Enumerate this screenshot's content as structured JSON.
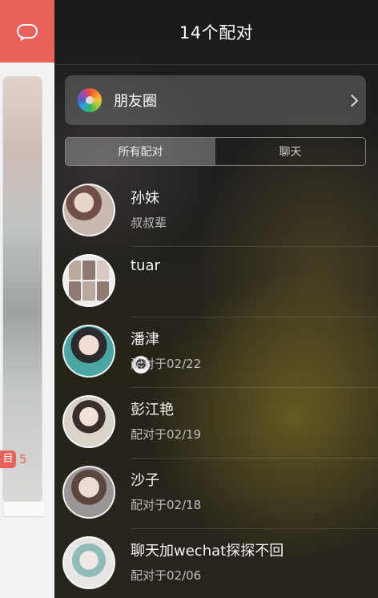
{
  "left_app": {
    "badge_glyph": "目",
    "count": "5",
    "accent_color": "#e8625a"
  },
  "header": {
    "title": "14个配对"
  },
  "moments": {
    "label": "朋友圈",
    "icon": "color-wheel-icon"
  },
  "tabs": [
    {
      "label": "所有配对",
      "active": true
    },
    {
      "label": "聊天",
      "active": false
    }
  ],
  "matches": [
    {
      "name": "孙妹",
      "subtitle": "叔叔辈"
    },
    {
      "name": "tuar",
      "subtitle": ""
    },
    {
      "name": "潘津",
      "subtitle": "配对于02/22"
    },
    {
      "name": "彭江艳",
      "subtitle": "配对于02/19"
    },
    {
      "name": "沙子",
      "subtitle": "配对于02/18"
    },
    {
      "name": "聊天加wechat探探不回",
      "subtitle": "配对于02/06"
    }
  ]
}
